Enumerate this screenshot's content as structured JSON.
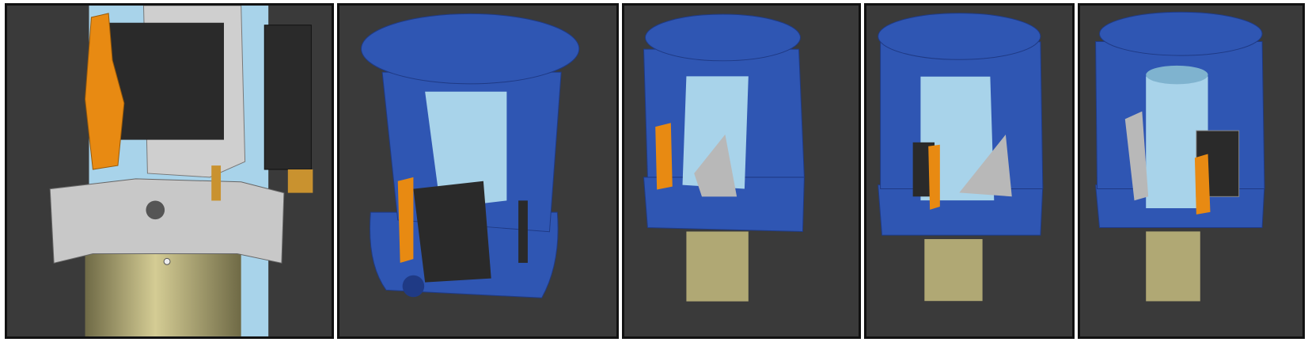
{
  "image": {
    "panel_count": 5,
    "palette": {
      "background": "#3a3a3a",
      "frame": "#111111",
      "housing_blue": "#2f56b3",
      "housing_blue_dark": "#1f3a85",
      "housing_blue_light": "#4a74d1",
      "tube_light_blue": "#a8d3ea",
      "servo_black": "#2a2a2a",
      "bracket_grey": "#b8b8b8",
      "servo_horn_orange": "#e88a12",
      "shaft_tan": "#b0a874",
      "shaft_tan_dark": "#7a7350"
    },
    "panels": [
      {
        "view": "close-up"
      },
      {
        "view": "perspective"
      },
      {
        "view": "front"
      },
      {
        "view": "side"
      },
      {
        "view": "rear"
      }
    ]
  }
}
